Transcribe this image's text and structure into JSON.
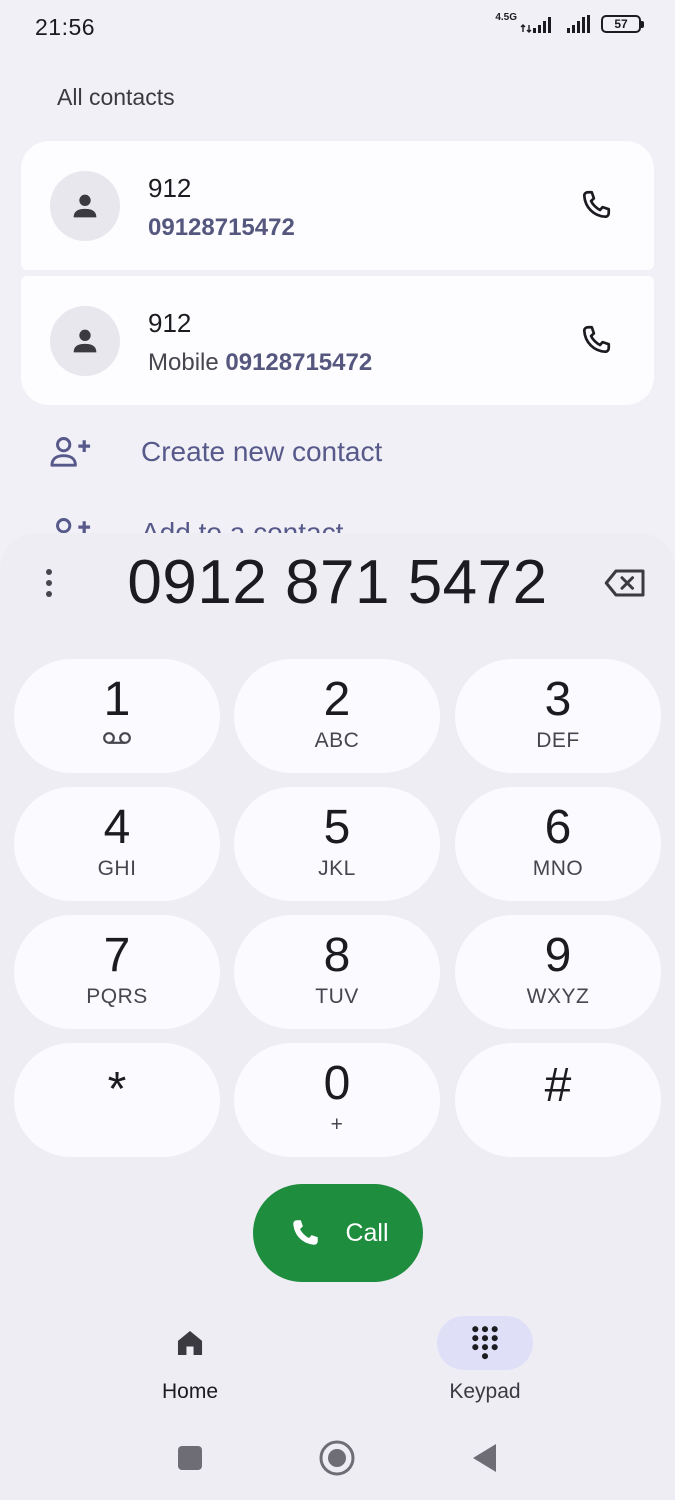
{
  "status_bar": {
    "time": "21:56",
    "network": "4.5G",
    "battery": "57"
  },
  "contacts": {
    "section_title": "All contacts",
    "items": [
      {
        "name": "912",
        "type": "",
        "number": "09128715472"
      },
      {
        "name": "912",
        "type": "Mobile ",
        "number": "09128715472"
      }
    ]
  },
  "actions": {
    "create_new": "Create new contact",
    "add_to": "Add to a contact"
  },
  "dialer": {
    "number": "0912 871 5472",
    "keys": [
      {
        "digit": "1",
        "letters": ""
      },
      {
        "digit": "2",
        "letters": "ABC"
      },
      {
        "digit": "3",
        "letters": "DEF"
      },
      {
        "digit": "4",
        "letters": "GHI"
      },
      {
        "digit": "5",
        "letters": "JKL"
      },
      {
        "digit": "6",
        "letters": "MNO"
      },
      {
        "digit": "7",
        "letters": "PQRS"
      },
      {
        "digit": "8",
        "letters": "TUV"
      },
      {
        "digit": "9",
        "letters": "WXYZ"
      },
      {
        "digit": "*",
        "letters": ""
      },
      {
        "digit": "0",
        "letters": "+"
      },
      {
        "digit": "#",
        "letters": ""
      }
    ],
    "call_label": "Call",
    "call_color": "#1e8d3d"
  },
  "bottom_nav": {
    "home": "Home",
    "keypad": "Keypad",
    "active": "keypad"
  },
  "colors": {
    "accent": "#55577e",
    "background": "#f1f0f6",
    "key_background": "#fbfaff"
  }
}
